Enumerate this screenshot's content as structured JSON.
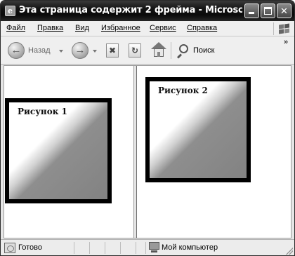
{
  "window": {
    "title": "Эта страница содержит 2 фрейма - Microsoft In...",
    "app_icon": "e-icon",
    "controls": [
      "minimize",
      "maximize",
      "close"
    ]
  },
  "menu": {
    "items": [
      {
        "label": "Файл",
        "id": "file"
      },
      {
        "label": "Правка",
        "id": "edit"
      },
      {
        "label": "Вид",
        "id": "view"
      },
      {
        "label": "Избранное",
        "id": "favorites"
      },
      {
        "label": "Сервис",
        "id": "tools"
      },
      {
        "label": "Справка",
        "id": "help"
      }
    ],
    "logo_icon": "windows-flag-icon"
  },
  "toolbar": {
    "back_label": "Назад",
    "search_label": "Поиск",
    "more_label": "»",
    "icons": [
      "back-arrow-icon",
      "forward-arrow-icon",
      "stop-icon",
      "refresh-icon",
      "home-icon",
      "search-icon"
    ]
  },
  "frames": {
    "left": {
      "picture_label": "Рисунок 1"
    },
    "right": {
      "picture_label": "Рисунок 2"
    }
  },
  "status": {
    "text": "Готово",
    "zone": "Мой компьютер"
  }
}
